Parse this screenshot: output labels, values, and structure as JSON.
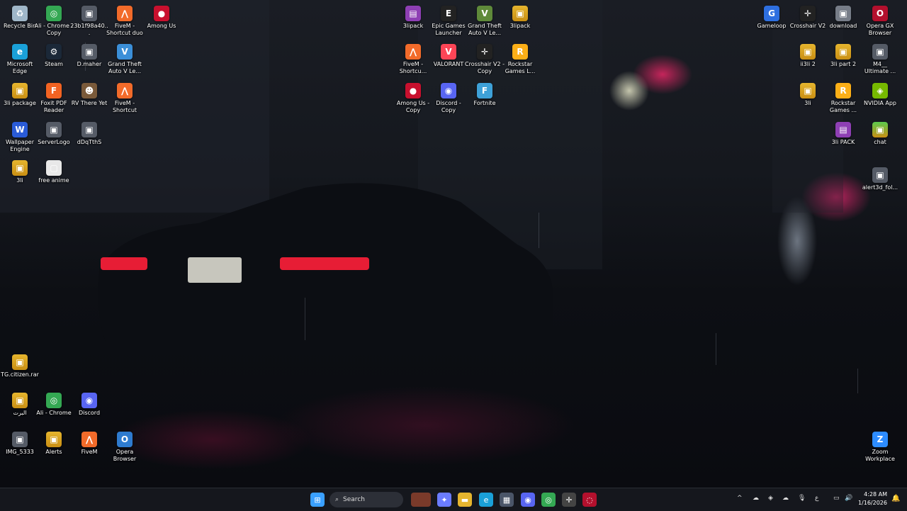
{
  "desktop": {
    "icons": [
      {
        "label": "Recycle Bin",
        "icon": "recycle-bin-icon",
        "color": "#9fb6c8"
      },
      {
        "label": "Ali - Chrome - Copy",
        "icon": "chrome-icon",
        "color": "#34a853"
      },
      {
        "label": "23b1f98a40...",
        "icon": "image-file-icon",
        "color": "#555b66"
      },
      {
        "label": "FiveM - Shortcut duo",
        "icon": "fivem-icon",
        "color": "#f26b2a"
      },
      {
        "label": "Among Us",
        "icon": "among-us-icon",
        "color": "#c8102e"
      },
      {
        "label": "Microsoft Edge",
        "icon": "edge-icon",
        "color": "#1aa0d8"
      },
      {
        "label": "Steam",
        "icon": "steam-icon",
        "color": "#1b2838"
      },
      {
        "label": "D.maher",
        "icon": "image-file-icon",
        "color": "#555b66"
      },
      {
        "label": "Grand Theft Auto V Le...",
        "icon": "gta-icon",
        "color": "#3b8fd8"
      },
      {
        "label": "3li package",
        "icon": "folder-icon",
        "color": "#e6b52e"
      },
      {
        "label": "Foxit PDF Reader",
        "icon": "foxit-icon",
        "color": "#f26322"
      },
      {
        "label": "RV There Yet",
        "icon": "game-icon",
        "color": "#7a5a3a"
      },
      {
        "label": "FiveM - Shortcut",
        "icon": "fivem-icon",
        "color": "#f26b2a"
      },
      {
        "label": "Wallpaper Engine",
        "icon": "wallpaper-engine-icon",
        "color": "#2a5bd7"
      },
      {
        "label": "ServerLogo",
        "icon": "image-file-icon",
        "color": "#555b66"
      },
      {
        "label": "dDqTthS",
        "icon": "image-file-icon",
        "color": "#555b66"
      },
      {
        "label": "3li",
        "icon": "folder-icon",
        "color": "#e6b52e"
      },
      {
        "label": "free anime",
        "icon": "file-icon",
        "color": "#e8e8e8"
      },
      {
        "label": "3lipack",
        "icon": "winrar-icon",
        "color": "#8e3fb4"
      },
      {
        "label": "Epic Games Launcher",
        "icon": "epic-icon",
        "color": "#222222"
      },
      {
        "label": "Grand Theft Auto V Le...",
        "icon": "gta-icon",
        "color": "#5f8a3a"
      },
      {
        "label": "3lipack",
        "icon": "folder-icon",
        "color": "#e6b52e"
      },
      {
        "label": "FiveM - Shortcu...",
        "icon": "fivem-icon",
        "color": "#f26b2a"
      },
      {
        "label": "VALORANT",
        "icon": "valorant-icon",
        "color": "#fd4556"
      },
      {
        "label": "Crosshair V2 - Copy",
        "icon": "crosshair-icon",
        "color": "#222222"
      },
      {
        "label": "Rockstar Games L...",
        "icon": "rockstar-icon",
        "color": "#fcaf17"
      },
      {
        "label": "Among Us - Copy",
        "icon": "among-us-icon",
        "color": "#c8102e"
      },
      {
        "label": "Discord - Copy",
        "icon": "discord-icon",
        "color": "#5865f2"
      },
      {
        "label": "Fortnite",
        "icon": "fortnite-icon",
        "color": "#3ea1d8"
      },
      {
        "label": "Gameloop",
        "icon": "gameloop-icon",
        "color": "#2e6fe0"
      },
      {
        "label": "Crosshair V2",
        "icon": "crosshair-icon",
        "color": "#222222"
      },
      {
        "label": "download",
        "icon": "image-file-icon",
        "color": "#777d88"
      },
      {
        "label": "Opera GX Browser",
        "icon": "opera-gx-icon",
        "color": "#b3102d"
      },
      {
        "label": "ii3li 2",
        "icon": "folder-icon",
        "color": "#e6b52e"
      },
      {
        "label": "3li part 2",
        "icon": "folder-icon",
        "color": "#e6b52e"
      },
      {
        "label": "M4__ Ultimate ...",
        "icon": "image-file-icon",
        "color": "#555b66"
      },
      {
        "label": "3li",
        "icon": "folder-icon",
        "color": "#e6b52e"
      },
      {
        "label": "Rockstar Games ...",
        "icon": "rockstar-icon",
        "color": "#fcaf17"
      },
      {
        "label": "NVIDIA App",
        "icon": "nvidia-icon",
        "color": "#76b900"
      },
      {
        "label": "3li PACK",
        "icon": "winrar-icon",
        "color": "#8e3fb4"
      },
      {
        "label": "chat",
        "icon": "folder-icon",
        "color": "#5cc94d"
      },
      {
        "label": "alert3d_fol...",
        "icon": "image-file-icon",
        "color": "#555b66"
      },
      {
        "label": "TG.citizen.rar",
        "icon": "folder-icon",
        "color": "#e6b52e"
      },
      {
        "label": "البرت",
        "icon": "folder-icon",
        "color": "#e6b52e"
      },
      {
        "label": "Ali - Chrome",
        "icon": "chrome-icon",
        "color": "#34a853"
      },
      {
        "label": "Discord",
        "icon": "discord-icon",
        "color": "#5865f2"
      },
      {
        "label": "IMG_5333",
        "icon": "image-file-icon",
        "color": "#555b66"
      },
      {
        "label": "Alerts",
        "icon": "folder-icon",
        "color": "#e6b52e"
      },
      {
        "label": "FiveM",
        "icon": "fivem-icon",
        "color": "#f26b2a"
      },
      {
        "label": "Opera Browser",
        "icon": "opera-icon",
        "color": "#2e7bcf"
      },
      {
        "label": "Zoom Workplace",
        "icon": "zoom-icon",
        "color": "#2d8cff"
      }
    ]
  },
  "taskbar": {
    "search_label": "Search",
    "apps": [
      {
        "name": "start-button",
        "glyph": "⊞",
        "color": "#3aa0ff"
      },
      {
        "name": "copilot-icon",
        "glyph": "✦",
        "color": "#6b7cff"
      },
      {
        "name": "file-explorer-icon",
        "glyph": "▬",
        "color": "#e6b52e"
      },
      {
        "name": "edge-taskbar-icon",
        "glyph": "e",
        "color": "#1aa0d8"
      },
      {
        "name": "store-icon",
        "glyph": "▦",
        "color": "#4a5568"
      },
      {
        "name": "discord-taskbar-icon",
        "glyph": "◉",
        "color": "#5865f2"
      },
      {
        "name": "chrome-taskbar-icon",
        "glyph": "◎",
        "color": "#34a853"
      },
      {
        "name": "crosshair-taskbar-icon",
        "glyph": "✛",
        "color": "#444"
      },
      {
        "name": "opera-gx-taskbar-icon",
        "glyph": "◌",
        "color": "#b3102d"
      }
    ],
    "tray": [
      "^",
      "☁",
      "◈",
      "☁",
      "🎙",
      "ع",
      "▭",
      "🔊",
      "🔋"
    ],
    "clock_time": "4:28 AM",
    "clock_date": "1/16/2026"
  }
}
